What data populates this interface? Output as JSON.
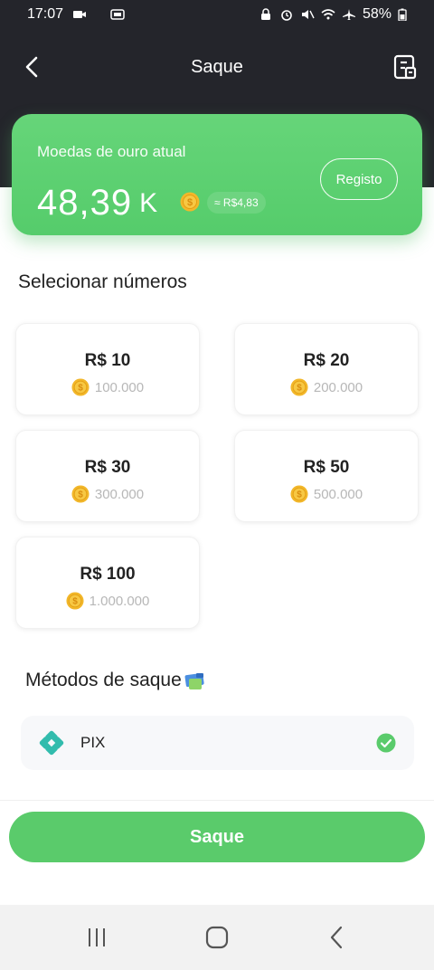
{
  "status_bar": {
    "time": "17:07",
    "battery": "58%"
  },
  "header": {
    "title": "Saque"
  },
  "balance": {
    "label": "Moedas de ouro atual",
    "amount": "48,39",
    "unit": "K",
    "approx": "≈ R$4,83",
    "registo_label": "Registo"
  },
  "amounts": {
    "title": "Selecionar números",
    "options": [
      {
        "label": "R$ 10",
        "coins": "100.000"
      },
      {
        "label": "R$ 20",
        "coins": "200.000"
      },
      {
        "label": "R$ 30",
        "coins": "300.000"
      },
      {
        "label": "R$ 50",
        "coins": "500.000"
      },
      {
        "label": "R$ 100",
        "coins": "1.000.000"
      }
    ]
  },
  "methods": {
    "title": "Métodos de saque",
    "items": [
      {
        "label": "PIX",
        "selected": true
      }
    ]
  },
  "actions": {
    "withdraw_label": "Saque"
  },
  "colors": {
    "accent": "#5acb6b",
    "header_bg": "#24252b",
    "coin": "#f2b72a",
    "pix": "#32bcad"
  }
}
